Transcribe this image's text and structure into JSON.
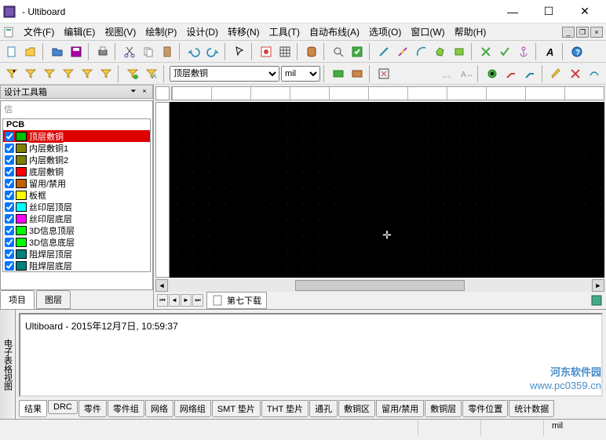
{
  "window": {
    "title": " - Ultiboard"
  },
  "menus": [
    {
      "label": "文件(F)"
    },
    {
      "label": "编辑(E)"
    },
    {
      "label": "视图(V)"
    },
    {
      "label": "绘制(P)"
    },
    {
      "label": "设计(D)"
    },
    {
      "label": "转移(N)"
    },
    {
      "label": "工具(T)"
    },
    {
      "label": "自动布线(A)"
    },
    {
      "label": "选项(O)"
    },
    {
      "label": "窗口(W)"
    },
    {
      "label": "帮助(H)"
    }
  ],
  "toolbar2": {
    "layer_combo": "顶层敷铜",
    "unit_combo": "mil"
  },
  "design_toolbox": {
    "title": "设计工具箱",
    "tree_root": "信",
    "pcb_group": "PCB",
    "layers": [
      {
        "name": "顶层敷铜",
        "color": "#00c000",
        "selected": true
      },
      {
        "name": "内层敷铜1",
        "color": "#808000"
      },
      {
        "name": "内层敷铜2",
        "color": "#808000"
      },
      {
        "name": "底层敷铜",
        "color": "#ff0000"
      },
      {
        "name": "留用/禁用",
        "color": "#c06000"
      },
      {
        "name": "板框",
        "color": "#ffff00"
      },
      {
        "name": "丝印层顶层",
        "color": "#00ffff"
      },
      {
        "name": "丝印层底层",
        "color": "#ff00ff"
      },
      {
        "name": "3D信息顶层",
        "color": "#00ff00"
      },
      {
        "name": "3D信息底层",
        "color": "#00ff00"
      },
      {
        "name": "阻焊层顶层",
        "color": "#008080"
      },
      {
        "name": "阻焊层底层",
        "color": "#008080"
      }
    ],
    "tabs": [
      {
        "label": "项目",
        "active": true
      },
      {
        "label": "图层"
      }
    ]
  },
  "doc_tab": {
    "label": "第七下载"
  },
  "log": {
    "vtab": "电子表格视图",
    "text": "Ultiboard  -  2015年12月7日, 10:59:37",
    "tabs": [
      {
        "label": "结果",
        "active": true
      },
      {
        "label": "DRC"
      },
      {
        "label": "零件"
      },
      {
        "label": "零件组"
      },
      {
        "label": "网络"
      },
      {
        "label": "网络组"
      },
      {
        "label": "SMT 垫片"
      },
      {
        "label": "THT 垫片"
      },
      {
        "label": "通孔"
      },
      {
        "label": "敷铜区"
      },
      {
        "label": "留用/禁用"
      },
      {
        "label": "敷铜层"
      },
      {
        "label": "零件位置"
      },
      {
        "label": "统计数据"
      }
    ]
  },
  "status": {
    "unit": "mil"
  },
  "watermark": {
    "cn": "河东软件园",
    "url": "www.pc0359.cn"
  }
}
